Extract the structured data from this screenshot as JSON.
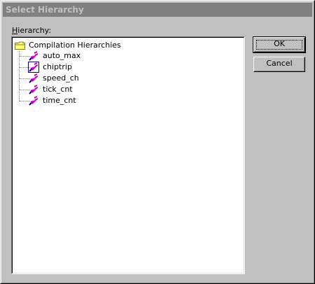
{
  "window": {
    "title": "Select Hierarchy"
  },
  "tree_label": {
    "accel": "H",
    "rest": "ierarchy:"
  },
  "tree": {
    "root": "Compilation Hierarchies",
    "items": [
      {
        "label": "auto_max"
      },
      {
        "label": "chiptrip",
        "selected": true
      },
      {
        "label": "speed_ch"
      },
      {
        "label": "tick_cnt"
      },
      {
        "label": "time_cnt"
      }
    ]
  },
  "buttons": {
    "ok": "OK",
    "cancel": "Cancel"
  },
  "colors": {
    "titlebar": "#808080",
    "face": "#c0c0c0",
    "icon_purple": "#c000c0",
    "icon_navy": "#000080"
  }
}
